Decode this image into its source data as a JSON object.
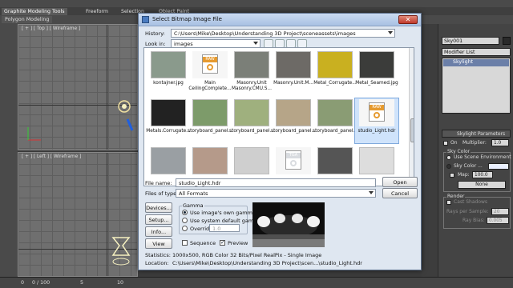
{
  "ribbon": {
    "tabs": [
      "Graphite Modeling Tools",
      "Freeform",
      "Selection",
      "Object Paint"
    ],
    "subtab": "Polygon Modeling"
  },
  "viewports": {
    "top_label": "[ + ] [ Top ] [ Wireframe ]",
    "left_label": "[ + ] [ Left ] [ Wireframe ]"
  },
  "command_panel": {
    "object_name": "Sky001",
    "modifier_list": "Modifier List",
    "stack_item": "Skylight",
    "rollout_title": "Skylight Parameters",
    "on_label": "On",
    "multiplier_label": "Multiplier:",
    "multiplier_value": "1.0",
    "sky_color_group": "Sky Color",
    "use_scene_env": "Use Scene Environment",
    "sky_color_label": "Sky Color ...",
    "map_label": "Map:",
    "map_value": "100.0",
    "map_button": "None",
    "render_group": "Render",
    "cast_shadows": "Cast Shadows",
    "rays_label": "Rays per Sample:",
    "rays_value": "20",
    "ray_bias_label": "Ray Bias:",
    "ray_bias_value": "0.005"
  },
  "status": {
    "frame": "0 / 100",
    "ticks": [
      "0",
      "5",
      "10"
    ]
  },
  "dialog": {
    "title": "Select Bitmap Image File",
    "close_glyph": "✕",
    "history_label": "History:",
    "history_value": "C:\\Users\\Mike\\Desktop\\Understanding 3D Project\\sceneassets\\images",
    "lookin_label": "Look in:",
    "lookin_value": "images",
    "files": [
      {
        "name": "kontajner.jpg",
        "color": "#8a9a8c"
      },
      {
        "name": "Main CeilingComplete...",
        "color": "#e69a2e",
        "raw": true
      },
      {
        "name": "Masonry.Unit Masonry.CMU.S...",
        "color": "#7b7f78"
      },
      {
        "name": "Masonry.Unit.M...",
        "color": "#6d6a66"
      },
      {
        "name": "Metal_Corrugate...",
        "color": "#c9b020"
      },
      {
        "name": "Metal_Seamed.jpg",
        "color": "#3b3c3a"
      },
      {
        "name": "Metals.Corrugate...",
        "color": "#222"
      },
      {
        "name": "storyboard_panel...",
        "color": "#7d9b6a"
      },
      {
        "name": "storyboard_panel...",
        "color": "#9fb07e"
      },
      {
        "name": "storyboard_panel...",
        "color": "#b6a588"
      },
      {
        "name": "storyboard_panel...",
        "color": "#8a9c74"
      },
      {
        "name": "studio_Light.hdr",
        "color": "#e69a2e",
        "raw": true,
        "selected": true
      },
      {
        "name": "",
        "color": "#9a9fa3"
      },
      {
        "name": "",
        "color": "#b59a8a"
      },
      {
        "name": "",
        "color": "#cfcfcf"
      },
      {
        "name": "",
        "color": "#d9dce0",
        "raw": true
      },
      {
        "name": "",
        "color": "#555"
      },
      {
        "name": "",
        "color": "#ddd"
      }
    ],
    "raw_badge": "RAW",
    "tga_badge": "TGA",
    "filename_label": "File name:",
    "filename_value": "studio_Light.hdr",
    "filetype_label": "Files of type:",
    "filetype_value": "All Formats",
    "open_button": "Open",
    "cancel_button": "Cancel",
    "devices_button": "Devices...",
    "setup_button": "Setup...",
    "info_button": "Info...",
    "view_button": "View",
    "gamma_group": "Gamma",
    "gamma_own": "Use image's own gamma",
    "gamma_system": "Use system default gamma",
    "gamma_override": "Override",
    "gamma_override_value": "1.0",
    "sequence_label": "Sequence",
    "preview_label": "Preview",
    "statistics_label": "Statistics:",
    "statistics_value": "1000x500, RGB Color 32 Bits/Pixel RealPix - Single Image",
    "location_label": "Location:",
    "location_value": "C:\\Users\\Mike\\Desktop\\Understanding 3D Project\\scen...\\studio_Light.hdr"
  }
}
